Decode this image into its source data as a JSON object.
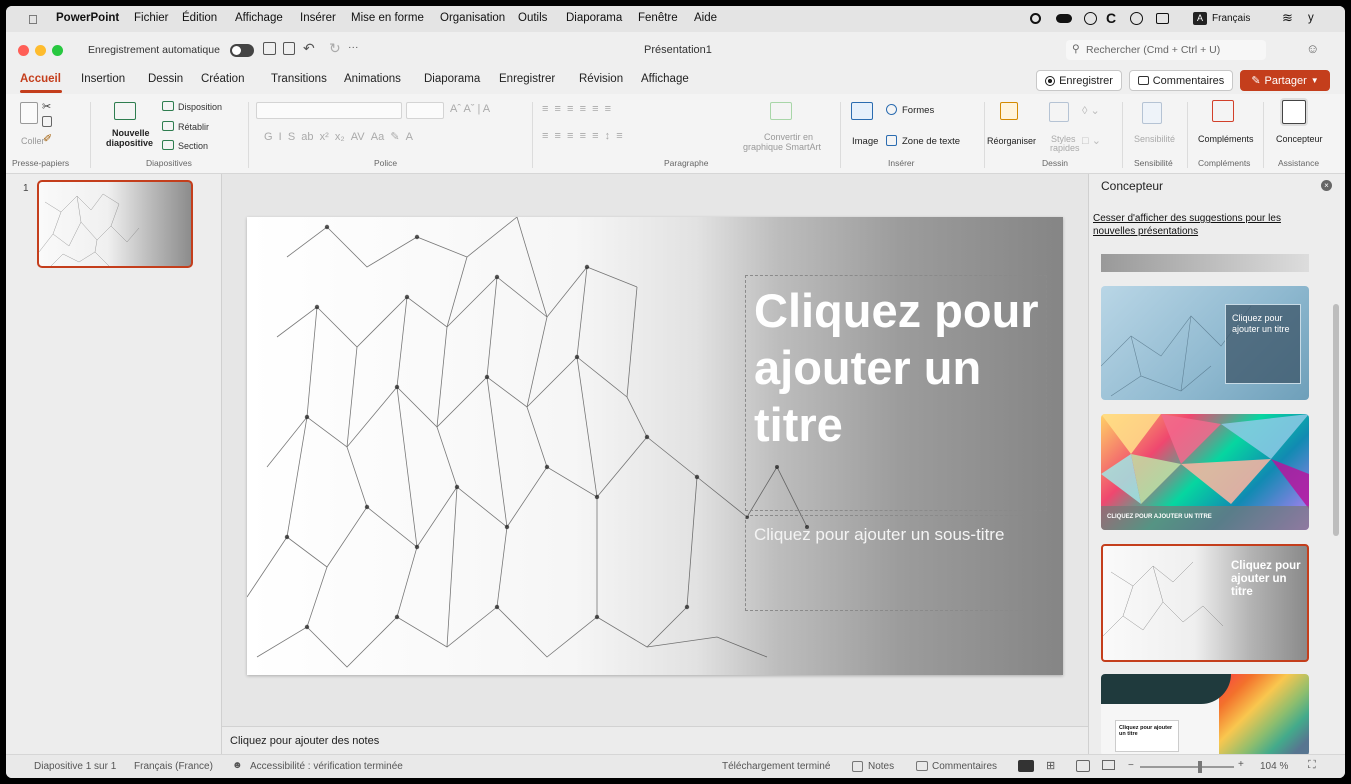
{
  "menubar": {
    "app": "PowerPoint",
    "items": [
      "Fichier",
      "Édition",
      "Affichage",
      "Insérer",
      "Mise en forme",
      "Organisation",
      "Outils",
      "Diaporama",
      "Fenêtre",
      "Aide"
    ],
    "input_source": "Français"
  },
  "titlebar": {
    "autosave": "Enregistrement automatique",
    "title": "Présentation1",
    "search_placeholder": "Rechercher (Cmd + Ctrl + U)"
  },
  "tabs": [
    "Accueil",
    "Insertion",
    "Dessin",
    "Création",
    "Transitions",
    "Animations",
    "Diaporama",
    "Enregistrer",
    "Révision",
    "Affichage"
  ],
  "tab_actions": {
    "record": "Enregistrer",
    "comments": "Commentaires",
    "share": "Partager"
  },
  "ribbon": {
    "clipboard": {
      "paste": "Coller",
      "group": "Presse-papiers"
    },
    "slides": {
      "new_slide_1": "Nouvelle",
      "new_slide_2": "diapositive",
      "layout": "Disposition",
      "reset": "Rétablir",
      "section": "Section",
      "group": "Diapositives"
    },
    "font": {
      "group": "Police"
    },
    "paragraph": {
      "smartart_1": "Convertir en",
      "smartart_2": "graphique SmartArt",
      "group": "Paragraphe"
    },
    "insert": {
      "image": "Image",
      "shapes": "Formes",
      "textbox": "Zone de texte",
      "group": "Insérer"
    },
    "drawing": {
      "arrange": "Réorganiser",
      "quick_styles_1": "Styles",
      "quick_styles_2": "rapides",
      "group": "Dessin"
    },
    "sensitivity": {
      "label": "Sensibilité",
      "group": "Sensibilité"
    },
    "addins": {
      "label": "Compléments",
      "group": "Compléments"
    },
    "assistance": {
      "label": "Concepteur",
      "group": "Assistance"
    }
  },
  "thumbnails": {
    "number": "1"
  },
  "slide": {
    "title": "Cliquez pour ajouter un titre",
    "subtitle": "Cliquez pour ajouter un sous-titre"
  },
  "notes": {
    "placeholder": "Cliquez pour ajouter des notes"
  },
  "designer": {
    "title": "Concepteur",
    "link": "Cesser d'afficher des suggestions pour les nouvelles présentations",
    "thumb1_title": "Cliquez pour ajouter un titre",
    "thumb2_title": "CLIQUEZ POUR AJOUTER UN TITRE",
    "thumb3_title": "Cliquez pour ajouter un titre",
    "thumb4_title": "Cliquez pour ajouter un titre"
  },
  "status": {
    "slide": "Diapositive 1 sur 1",
    "language": "Français (France)",
    "accessibility": "Accessibilité : vérification terminée",
    "download": "Téléchargement terminé",
    "notes": "Notes",
    "comments": "Commentaires",
    "zoom": "104 %"
  },
  "colors": {
    "accent": "#c43e1c",
    "share": "#c43e1c"
  }
}
